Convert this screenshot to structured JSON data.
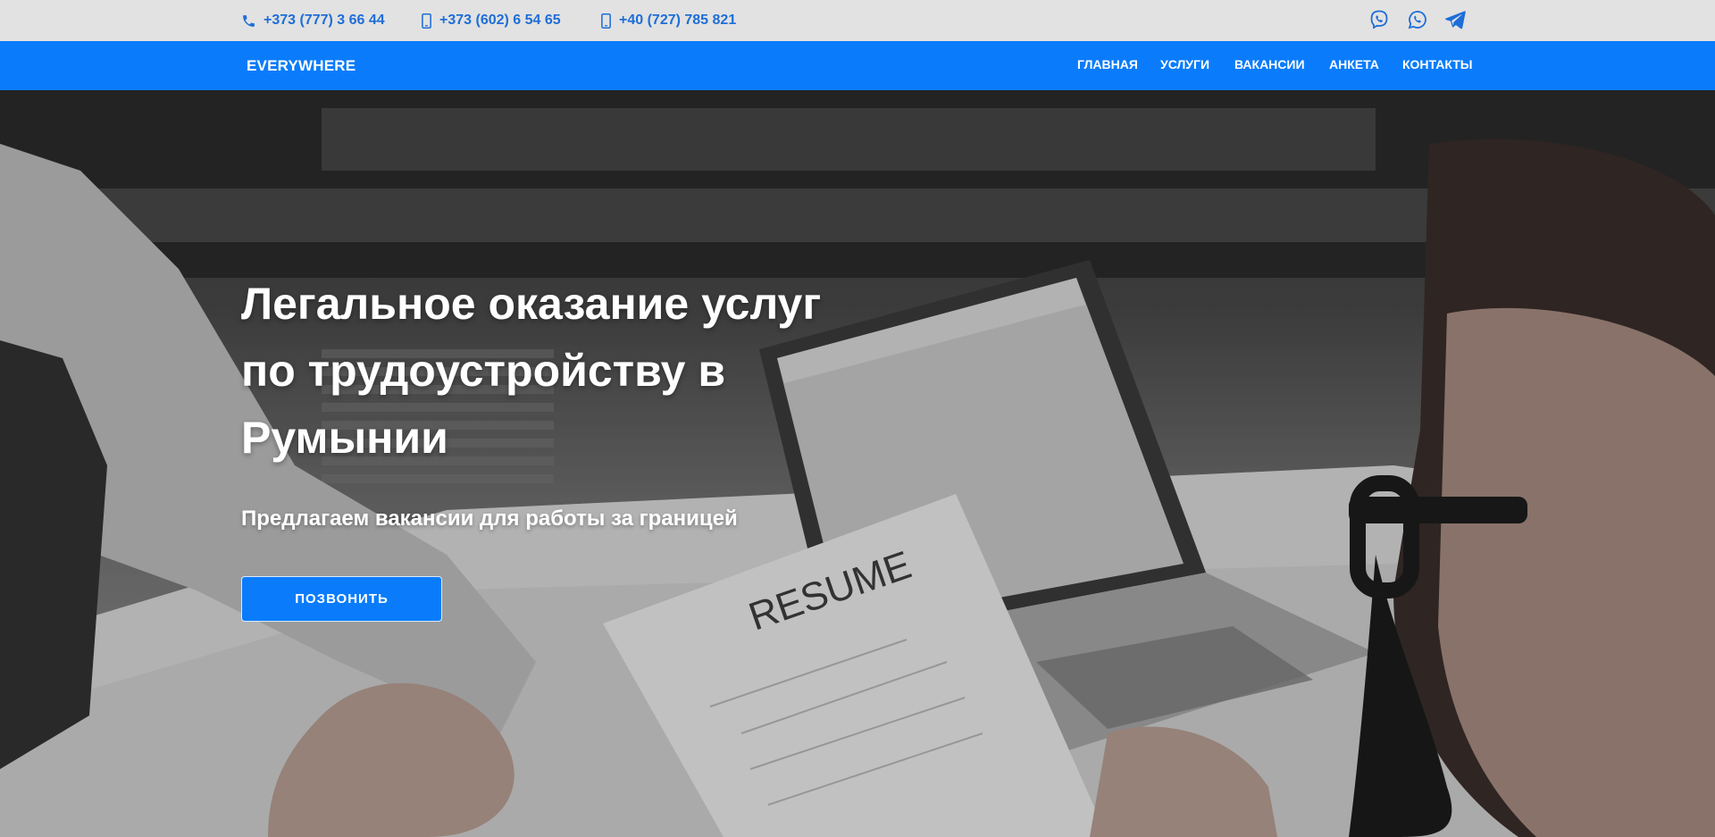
{
  "topbar": {
    "phones": [
      {
        "icon": "phone-icon",
        "number": "+373 (777) 3 66 44"
      },
      {
        "icon": "mobile-icon",
        "number": "+373 (602) 6 54 65"
      },
      {
        "icon": "mobile-icon",
        "number": "+40 (727) 785 821"
      }
    ],
    "social": [
      {
        "icon": "viber-icon"
      },
      {
        "icon": "whatsapp-icon"
      },
      {
        "icon": "telegram-icon"
      }
    ]
  },
  "navbar": {
    "brand": "EVERYWHERE",
    "items": [
      {
        "label": "ГЛАВНАЯ"
      },
      {
        "label": "УСЛУГИ"
      },
      {
        "label": "ВАКАНСИИ"
      },
      {
        "label": "АНКЕТА"
      },
      {
        "label": "КОНТАКТЫ"
      }
    ]
  },
  "hero": {
    "title_lines": [
      "Легальное оказание услуг",
      "по трудоустройству в",
      "Румынии"
    ],
    "subtitle": "Предлагаем вакансии для работы за границей",
    "button_label": "ПОЗВОНИТЬ",
    "resume_label": "RESUME"
  },
  "colors": {
    "accent": "#0a7cfb",
    "topbar_bg": "#e2e2e2",
    "contact_text": "#1e6ed8"
  }
}
